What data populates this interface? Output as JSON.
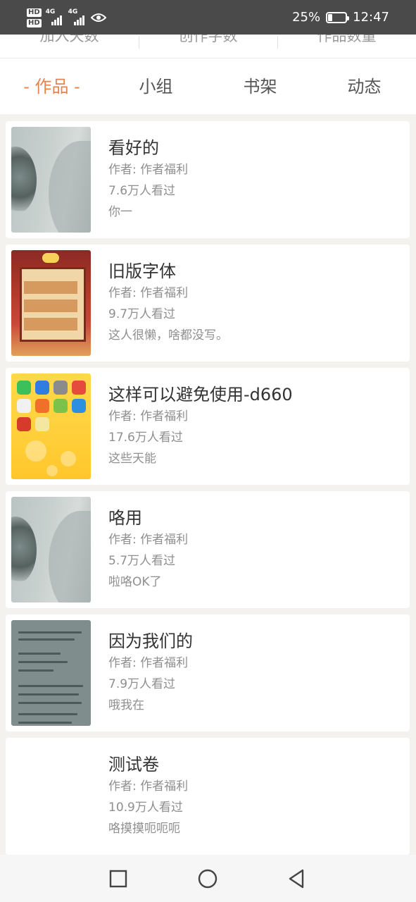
{
  "status_bar": {
    "hd1": "HD",
    "hd2": "HD",
    "net1": "4G",
    "net2": "4G",
    "battery_percent": "25%",
    "battery_level": 0.25,
    "time": "12:47"
  },
  "stats": {
    "labels": [
      "加入天数",
      "创作字数",
      "作品数量"
    ]
  },
  "tabs": {
    "items": [
      {
        "label": "- 作品 -",
        "active": true
      },
      {
        "label": "小组",
        "active": false
      },
      {
        "label": "书架",
        "active": false
      },
      {
        "label": "动态",
        "active": false
      }
    ]
  },
  "works": [
    {
      "title": "看好的",
      "author": "作者: 作者福利",
      "views": "7.6万人看过",
      "desc": "你一",
      "thumb": "wall"
    },
    {
      "title": "旧版字体",
      "author": "作者: 作者福利",
      "views": "9.7万人看过",
      "desc": "这人很懒，啥都没写。",
      "thumb": "game"
    },
    {
      "title": "这样可以避免使用-d660",
      "author": "作者: 作者福利",
      "views": "17.6万人看过",
      "desc": "这些天能",
      "thumb": "phone"
    },
    {
      "title": "咯用",
      "author": "作者: 作者福利",
      "views": "5.7万人看过",
      "desc": "啦咯OK了",
      "thumb": "wall"
    },
    {
      "title": "因为我们的",
      "author": "作者: 作者福利",
      "views": "7.9万人看过",
      "desc": "哦我在",
      "thumb": "doc"
    },
    {
      "title": "测试卷",
      "author": "作者: 作者福利",
      "views": "10.9万人看过",
      "desc": "咯摸摸呃呃呃",
      "thumb": "none"
    }
  ],
  "colors": {
    "accent": "#e8834e",
    "status_bar": "#4a4a4a",
    "background": "#f3f2ef"
  }
}
